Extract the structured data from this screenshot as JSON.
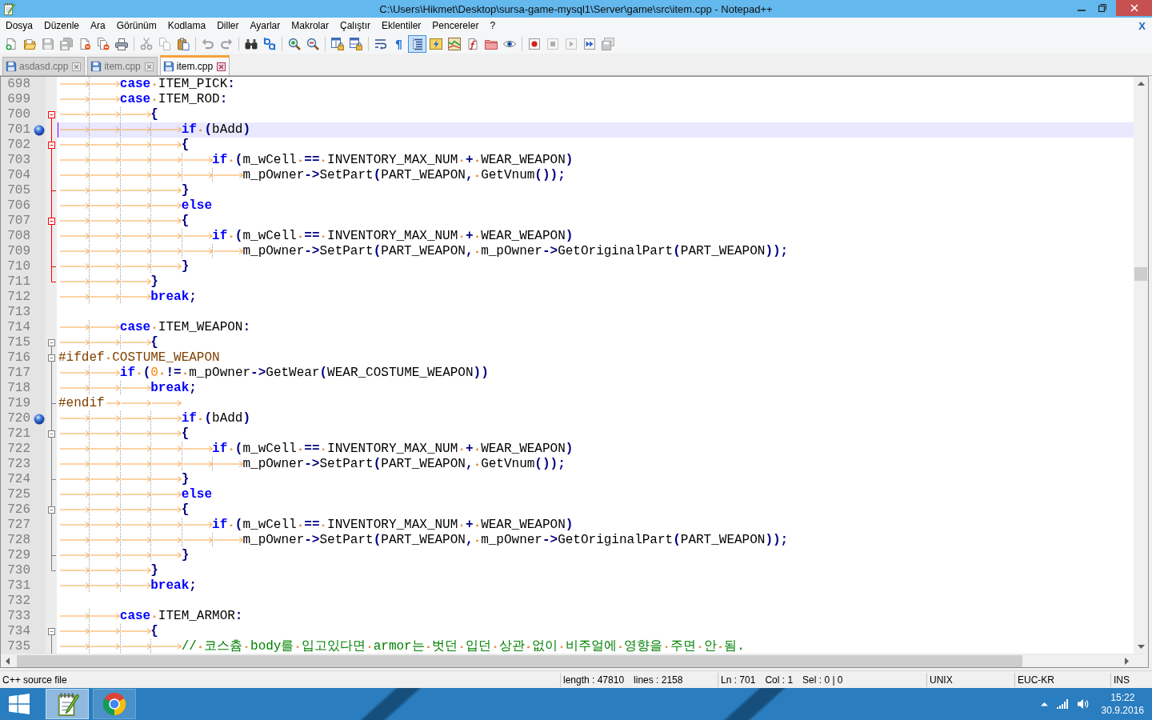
{
  "window": {
    "title": "C:\\Users\\Hikmet\\Desktop\\sursa-game-mysql1\\Server\\game\\src\\item.cpp - Notepad++"
  },
  "menu_bar": {
    "items": [
      "Dosya",
      "Düzenle",
      "Ara",
      "Görünüm",
      "Kodlama",
      "Diller",
      "Ayarlar",
      "Makrolar",
      "Çalıştır",
      "Eklentiler",
      "Pencereler",
      "?"
    ],
    "close_button": "X"
  },
  "toolbar": {
    "groups": [
      [
        {
          "kind": "new",
          "disabled": false,
          "pressed": false
        },
        {
          "kind": "open",
          "disabled": false,
          "pressed": false
        },
        {
          "kind": "save",
          "disabled": true,
          "pressed": false
        },
        {
          "kind": "save_all",
          "disabled": true,
          "pressed": false
        },
        {
          "kind": "close",
          "disabled": false,
          "pressed": false
        },
        {
          "kind": "close_all",
          "disabled": false,
          "pressed": false
        },
        {
          "kind": "print",
          "disabled": false,
          "pressed": false
        }
      ],
      [
        {
          "kind": "cut",
          "disabled": true,
          "pressed": false
        },
        {
          "kind": "copy",
          "disabled": true,
          "pressed": false
        },
        {
          "kind": "paste",
          "disabled": false,
          "pressed": false
        }
      ],
      [
        {
          "kind": "undo",
          "disabled": true,
          "pressed": false
        },
        {
          "kind": "redo",
          "disabled": true,
          "pressed": false
        }
      ],
      [
        {
          "kind": "find",
          "disabled": false,
          "pressed": false
        },
        {
          "kind": "replace",
          "disabled": false,
          "pressed": false
        }
      ],
      [
        {
          "kind": "zoom_in",
          "disabled": false,
          "pressed": false
        },
        {
          "kind": "zoom_out",
          "disabled": false,
          "pressed": false
        }
      ],
      [
        {
          "kind": "sync_vertical",
          "disabled": false,
          "pressed": false
        },
        {
          "kind": "sync_horizontal",
          "disabled": false,
          "pressed": false
        }
      ],
      [
        {
          "kind": "word_wrap",
          "disabled": false,
          "pressed": false
        },
        {
          "kind": "show_all_characters",
          "label": "¶",
          "disabled": false,
          "pressed": false
        },
        {
          "kind": "indent_guide",
          "disabled": false,
          "pressed": true
        },
        {
          "kind": "user_language",
          "disabled": false,
          "pressed": false
        },
        {
          "kind": "document_map",
          "disabled": false,
          "pressed": false
        },
        {
          "kind": "function_list",
          "disabled": false,
          "pressed": false
        },
        {
          "kind": "folder_workspace",
          "disabled": false,
          "pressed": false
        },
        {
          "kind": "monitoring",
          "disabled": false,
          "pressed": false
        }
      ],
      [
        {
          "kind": "record",
          "disabled": false,
          "pressed": false
        },
        {
          "kind": "stop",
          "disabled": true,
          "pressed": false
        },
        {
          "kind": "play",
          "disabled": true,
          "pressed": false
        },
        {
          "kind": "play_multiple",
          "disabled": false,
          "pressed": false
        },
        {
          "kind": "save_macro",
          "disabled": true,
          "pressed": false
        }
      ]
    ]
  },
  "tabs": [
    {
      "label": "asdasd.cpp",
      "selected": false
    },
    {
      "label": "item.cpp",
      "selected": false
    },
    {
      "label": "item.cpp",
      "selected": true
    }
  ],
  "editor": {
    "lines": [
      {
        "number": "698",
        "bookmarked": false,
        "current": false,
        "segments": [
          {
            "kind": "keyword",
            "text": "\t\tcase"
          },
          {
            "kind": "plain",
            "text": " ITEM_PICK"
          },
          {
            "kind": "operator",
            "text": ":"
          }
        ]
      },
      {
        "number": "699",
        "bookmarked": false,
        "current": false,
        "segments": [
          {
            "kind": "keyword",
            "text": "\t\tcase"
          },
          {
            "kind": "plain",
            "text": " ITEM_ROD"
          },
          {
            "kind": "operator",
            "text": ":"
          }
        ]
      },
      {
        "number": "700",
        "bookmarked": false,
        "current": false,
        "fold": {
          "kind": "start",
          "highlighted": true
        },
        "segments": [
          {
            "kind": "operator",
            "text": "\t\t\t{"
          }
        ]
      },
      {
        "number": "701",
        "bookmarked": true,
        "current": true,
        "fold": {
          "kind": "inside",
          "highlighted": true
        },
        "segments": [
          {
            "kind": "keyword",
            "text": "\t\t\t\tif"
          },
          {
            "kind": "operator",
            "text": " ("
          },
          {
            "kind": "plain",
            "text": "bAdd"
          },
          {
            "kind": "operator",
            "text": ")"
          }
        ]
      },
      {
        "number": "702",
        "bookmarked": false,
        "current": false,
        "fold": {
          "kind": "start",
          "highlighted": true
        },
        "segments": [
          {
            "kind": "operator",
            "text": "\t\t\t\t{"
          }
        ]
      },
      {
        "number": "703",
        "bookmarked": false,
        "current": false,
        "fold": {
          "kind": "inside",
          "highlighted": true
        },
        "segments": [
          {
            "kind": "keyword",
            "text": "\t\t\t\t\tif"
          },
          {
            "kind": "operator",
            "text": " ("
          },
          {
            "kind": "plain",
            "text": "m_wCell "
          },
          {
            "kind": "operator",
            "text": "=="
          },
          {
            "kind": "plain",
            "text": " INVENTORY_MAX_NUM "
          },
          {
            "kind": "operator",
            "text": "+"
          },
          {
            "kind": "plain",
            "text": " WEAR_WEAPON"
          },
          {
            "kind": "operator",
            "text": ")"
          }
        ]
      },
      {
        "number": "704",
        "bookmarked": false,
        "current": false,
        "fold": {
          "kind": "inside",
          "highlighted": true
        },
        "segments": [
          {
            "kind": "plain",
            "text": "\t\t\t\t\t\tm_pOwner"
          },
          {
            "kind": "operator",
            "text": "->"
          },
          {
            "kind": "plain",
            "text": "SetPart"
          },
          {
            "kind": "operator",
            "text": "("
          },
          {
            "kind": "plain",
            "text": "PART_WEAPON"
          },
          {
            "kind": "operator",
            "text": ","
          },
          {
            "kind": "plain",
            "text": " GetVnum"
          },
          {
            "kind": "operator",
            "text": "());"
          }
        ]
      },
      {
        "number": "705",
        "bookmarked": false,
        "current": false,
        "fold": {
          "kind": "end",
          "highlighted": true
        },
        "segments": [
          {
            "kind": "operator",
            "text": "\t\t\t\t}"
          }
        ]
      },
      {
        "number": "706",
        "bookmarked": false,
        "current": false,
        "fold": {
          "kind": "inside",
          "highlighted": true
        },
        "segments": [
          {
            "kind": "keyword",
            "text": "\t\t\t\telse"
          }
        ]
      },
      {
        "number": "707",
        "bookmarked": false,
        "current": false,
        "fold": {
          "kind": "start",
          "highlighted": true
        },
        "segments": [
          {
            "kind": "operator",
            "text": "\t\t\t\t{"
          }
        ]
      },
      {
        "number": "708",
        "bookmarked": false,
        "current": false,
        "fold": {
          "kind": "inside",
          "highlighted": true
        },
        "segments": [
          {
            "kind": "keyword",
            "text": "\t\t\t\t\tif"
          },
          {
            "kind": "operator",
            "text": " ("
          },
          {
            "kind": "plain",
            "text": "m_wCell "
          },
          {
            "kind": "operator",
            "text": "=="
          },
          {
            "kind": "plain",
            "text": " INVENTORY_MAX_NUM "
          },
          {
            "kind": "operator",
            "text": "+"
          },
          {
            "kind": "plain",
            "text": " WEAR_WEAPON"
          },
          {
            "kind": "operator",
            "text": ")"
          }
        ]
      },
      {
        "number": "709",
        "bookmarked": false,
        "current": false,
        "fold": {
          "kind": "inside",
          "highlighted": true
        },
        "segments": [
          {
            "kind": "plain",
            "text": "\t\t\t\t\t\tm_pOwner"
          },
          {
            "kind": "operator",
            "text": "->"
          },
          {
            "kind": "plain",
            "text": "SetPart"
          },
          {
            "kind": "operator",
            "text": "("
          },
          {
            "kind": "plain",
            "text": "PART_WEAPON"
          },
          {
            "kind": "operator",
            "text": ","
          },
          {
            "kind": "plain",
            "text": " m_pOwner"
          },
          {
            "kind": "operator",
            "text": "->"
          },
          {
            "kind": "plain",
            "text": "GetOriginalPart"
          },
          {
            "kind": "operator",
            "text": "("
          },
          {
            "kind": "plain",
            "text": "PART_WEAPON"
          },
          {
            "kind": "operator",
            "text": "));"
          }
        ]
      },
      {
        "number": "710",
        "bookmarked": false,
        "current": false,
        "fold": {
          "kind": "end",
          "highlighted": true
        },
        "segments": [
          {
            "kind": "operator",
            "text": "\t\t\t\t}"
          }
        ]
      },
      {
        "number": "711",
        "bookmarked": false,
        "current": false,
        "fold": {
          "kind": "end",
          "highlighted": true
        },
        "segments": [
          {
            "kind": "operator",
            "text": "\t\t\t}"
          }
        ]
      },
      {
        "number": "712",
        "bookmarked": false,
        "current": false,
        "segments": [
          {
            "kind": "keyword",
            "text": "\t\t\tbreak"
          },
          {
            "kind": "operator",
            "text": ";"
          }
        ]
      },
      {
        "number": "713",
        "bookmarked": false,
        "current": false
      },
      {
        "number": "714",
        "bookmarked": false,
        "current": false,
        "segments": [
          {
            "kind": "keyword",
            "text": "\t\tcase"
          },
          {
            "kind": "plain",
            "text": " ITEM_WEAPON"
          },
          {
            "kind": "operator",
            "text": ":"
          }
        ]
      },
      {
        "number": "715",
        "bookmarked": false,
        "current": false,
        "fold": {
          "kind": "start",
          "highlighted": false
        },
        "segments": [
          {
            "kind": "operator",
            "text": "\t\t\t{"
          }
        ]
      },
      {
        "number": "716",
        "bookmarked": false,
        "current": false,
        "fold": {
          "kind": "start",
          "highlighted": false
        },
        "segments": [
          {
            "kind": "preprocessor",
            "text": "#ifdef COSTUME_WEAPON"
          }
        ]
      },
      {
        "number": "717",
        "bookmarked": false,
        "current": false,
        "fold": {
          "kind": "inside",
          "highlighted": false
        },
        "segments": [
          {
            "kind": "keyword",
            "text": "\t\tif"
          },
          {
            "kind": "operator",
            "text": " ("
          },
          {
            "kind": "number",
            "text": "0"
          },
          {
            "kind": "operator",
            "text": " !="
          },
          {
            "kind": "plain",
            "text": " m_pOwner"
          },
          {
            "kind": "operator",
            "text": "->"
          },
          {
            "kind": "plain",
            "text": "GetWear"
          },
          {
            "kind": "operator",
            "text": "("
          },
          {
            "kind": "plain",
            "text": "WEAR_COSTUME_WEAPON"
          },
          {
            "kind": "operator",
            "text": "))"
          }
        ]
      },
      {
        "number": "718",
        "bookmarked": false,
        "current": false,
        "fold": {
          "kind": "inside",
          "highlighted": false
        },
        "segments": [
          {
            "kind": "keyword",
            "text": "\t\t\tbreak"
          },
          {
            "kind": "operator",
            "text": ";"
          }
        ]
      },
      {
        "number": "719",
        "bookmarked": false,
        "current": false,
        "fold": {
          "kind": "end",
          "highlighted": false
        },
        "segments": [
          {
            "kind": "preprocessor",
            "text": "#endif\t\t\t"
          }
        ]
      },
      {
        "number": "720",
        "bookmarked": true,
        "current": false,
        "fold": {
          "kind": "inside",
          "highlighted": false
        },
        "segments": [
          {
            "kind": "keyword",
            "text": "\t\t\t\tif"
          },
          {
            "kind": "operator",
            "text": " ("
          },
          {
            "kind": "plain",
            "text": "bAdd"
          },
          {
            "kind": "operator",
            "text": ")"
          }
        ]
      },
      {
        "number": "721",
        "bookmarked": false,
        "current": false,
        "fold": {
          "kind": "start",
          "highlighted": false
        },
        "segments": [
          {
            "kind": "operator",
            "text": "\t\t\t\t{"
          }
        ]
      },
      {
        "number": "722",
        "bookmarked": false,
        "current": false,
        "fold": {
          "kind": "inside",
          "highlighted": false
        },
        "segments": [
          {
            "kind": "keyword",
            "text": "\t\t\t\t\tif"
          },
          {
            "kind": "operator",
            "text": " ("
          },
          {
            "kind": "plain",
            "text": "m_wCell "
          },
          {
            "kind": "operator",
            "text": "=="
          },
          {
            "kind": "plain",
            "text": " INVENTORY_MAX_NUM "
          },
          {
            "kind": "operator",
            "text": "+"
          },
          {
            "kind": "plain",
            "text": " WEAR_WEAPON"
          },
          {
            "kind": "operator",
            "text": ")"
          }
        ]
      },
      {
        "number": "723",
        "bookmarked": false,
        "current": false,
        "fold": {
          "kind": "inside",
          "highlighted": false
        },
        "segments": [
          {
            "kind": "plain",
            "text": "\t\t\t\t\t\tm_pOwner"
          },
          {
            "kind": "operator",
            "text": "->"
          },
          {
            "kind": "plain",
            "text": "SetPart"
          },
          {
            "kind": "operator",
            "text": "("
          },
          {
            "kind": "plain",
            "text": "PART_WEAPON"
          },
          {
            "kind": "operator",
            "text": ","
          },
          {
            "kind": "plain",
            "text": " GetVnum"
          },
          {
            "kind": "operator",
            "text": "());"
          }
        ]
      },
      {
        "number": "724",
        "bookmarked": false,
        "current": false,
        "fold": {
          "kind": "end",
          "highlighted": false
        },
        "segments": [
          {
            "kind": "operator",
            "text": "\t\t\t\t}"
          }
        ]
      },
      {
        "number": "725",
        "bookmarked": false,
        "current": false,
        "fold": {
          "kind": "inside",
          "highlighted": false
        },
        "segments": [
          {
            "kind": "keyword",
            "text": "\t\t\t\telse"
          }
        ]
      },
      {
        "number": "726",
        "bookmarked": false,
        "current": false,
        "fold": {
          "kind": "start",
          "highlighted": false
        },
        "segments": [
          {
            "kind": "operator",
            "text": "\t\t\t\t{"
          }
        ]
      },
      {
        "number": "727",
        "bookmarked": false,
        "current": false,
        "fold": {
          "kind": "inside",
          "highlighted": false
        },
        "segments": [
          {
            "kind": "keyword",
            "text": "\t\t\t\t\tif"
          },
          {
            "kind": "operator",
            "text": " ("
          },
          {
            "kind": "plain",
            "text": "m_wCell "
          },
          {
            "kind": "operator",
            "text": "=="
          },
          {
            "kind": "plain",
            "text": " INVENTORY_MAX_NUM "
          },
          {
            "kind": "operator",
            "text": "+"
          },
          {
            "kind": "plain",
            "text": " WEAR_WEAPON"
          },
          {
            "kind": "operator",
            "text": ")"
          }
        ]
      },
      {
        "number": "728",
        "bookmarked": false,
        "current": false,
        "fold": {
          "kind": "inside",
          "highlighted": false
        },
        "segments": [
          {
            "kind": "plain",
            "text": "\t\t\t\t\t\tm_pOwner"
          },
          {
            "kind": "operator",
            "text": "->"
          },
          {
            "kind": "plain",
            "text": "SetPart"
          },
          {
            "kind": "operator",
            "text": "("
          },
          {
            "kind": "plain",
            "text": "PART_WEAPON"
          },
          {
            "kind": "operator",
            "text": ","
          },
          {
            "kind": "plain",
            "text": " m_pOwner"
          },
          {
            "kind": "operator",
            "text": "->"
          },
          {
            "kind": "plain",
            "text": "GetOriginalPart"
          },
          {
            "kind": "operator",
            "text": "("
          },
          {
            "kind": "plain",
            "text": "PART_WEAPON"
          },
          {
            "kind": "operator",
            "text": "));"
          }
        ]
      },
      {
        "number": "729",
        "bookmarked": false,
        "current": false,
        "fold": {
          "kind": "end",
          "highlighted": false
        },
        "segments": [
          {
            "kind": "operator",
            "text": "\t\t\t\t}"
          }
        ]
      },
      {
        "number": "730",
        "bookmarked": false,
        "current": false,
        "fold": {
          "kind": "end",
          "highlighted": false
        },
        "segments": [
          {
            "kind": "operator",
            "text": "\t\t\t}"
          }
        ]
      },
      {
        "number": "731",
        "bookmarked": false,
        "current": false,
        "segments": [
          {
            "kind": "keyword",
            "text": "\t\t\tbreak"
          },
          {
            "kind": "operator",
            "text": ";"
          }
        ]
      },
      {
        "number": "732",
        "bookmarked": false,
        "current": false
      },
      {
        "number": "733",
        "bookmarked": false,
        "current": false,
        "segments": [
          {
            "kind": "keyword",
            "text": "\t\tcase"
          },
          {
            "kind": "plain",
            "text": " ITEM_ARMOR"
          },
          {
            "kind": "operator",
            "text": ":"
          }
        ]
      },
      {
        "number": "734",
        "bookmarked": false,
        "current": false,
        "fold": {
          "kind": "start",
          "highlighted": false
        },
        "segments": [
          {
            "kind": "operator",
            "text": "\t\t\t{"
          }
        ]
      },
      {
        "number": "735",
        "bookmarked": false,
        "current": false,
        "fold": {
          "kind": "inside",
          "highlighted": false
        },
        "segments": [
          {
            "kind": "comment",
            "text": "\t\t\t\t// 코스츔 body를 입고있다면 armor는 벗던 입던 상관 없이 비주얼에 영향을 주면 안 됨."
          }
        ]
      }
    ]
  },
  "status_bar": [
    [
      "C++ source file"
    ],
    [
      "length : 47810",
      "lines : 2158"
    ],
    [
      "Ln : 701",
      "Col : 1",
      "Sel : 0 | 0"
    ],
    [
      "UNIX"
    ],
    [
      "EUC-KR"
    ],
    [
      "INS"
    ]
  ],
  "taskbar": {
    "apps": [
      {
        "kind": "notepad",
        "selected": true
      },
      {
        "kind": "browser",
        "selected": false
      }
    ],
    "clock": {
      "time": "15:22",
      "date": "30.9.2016"
    }
  }
}
